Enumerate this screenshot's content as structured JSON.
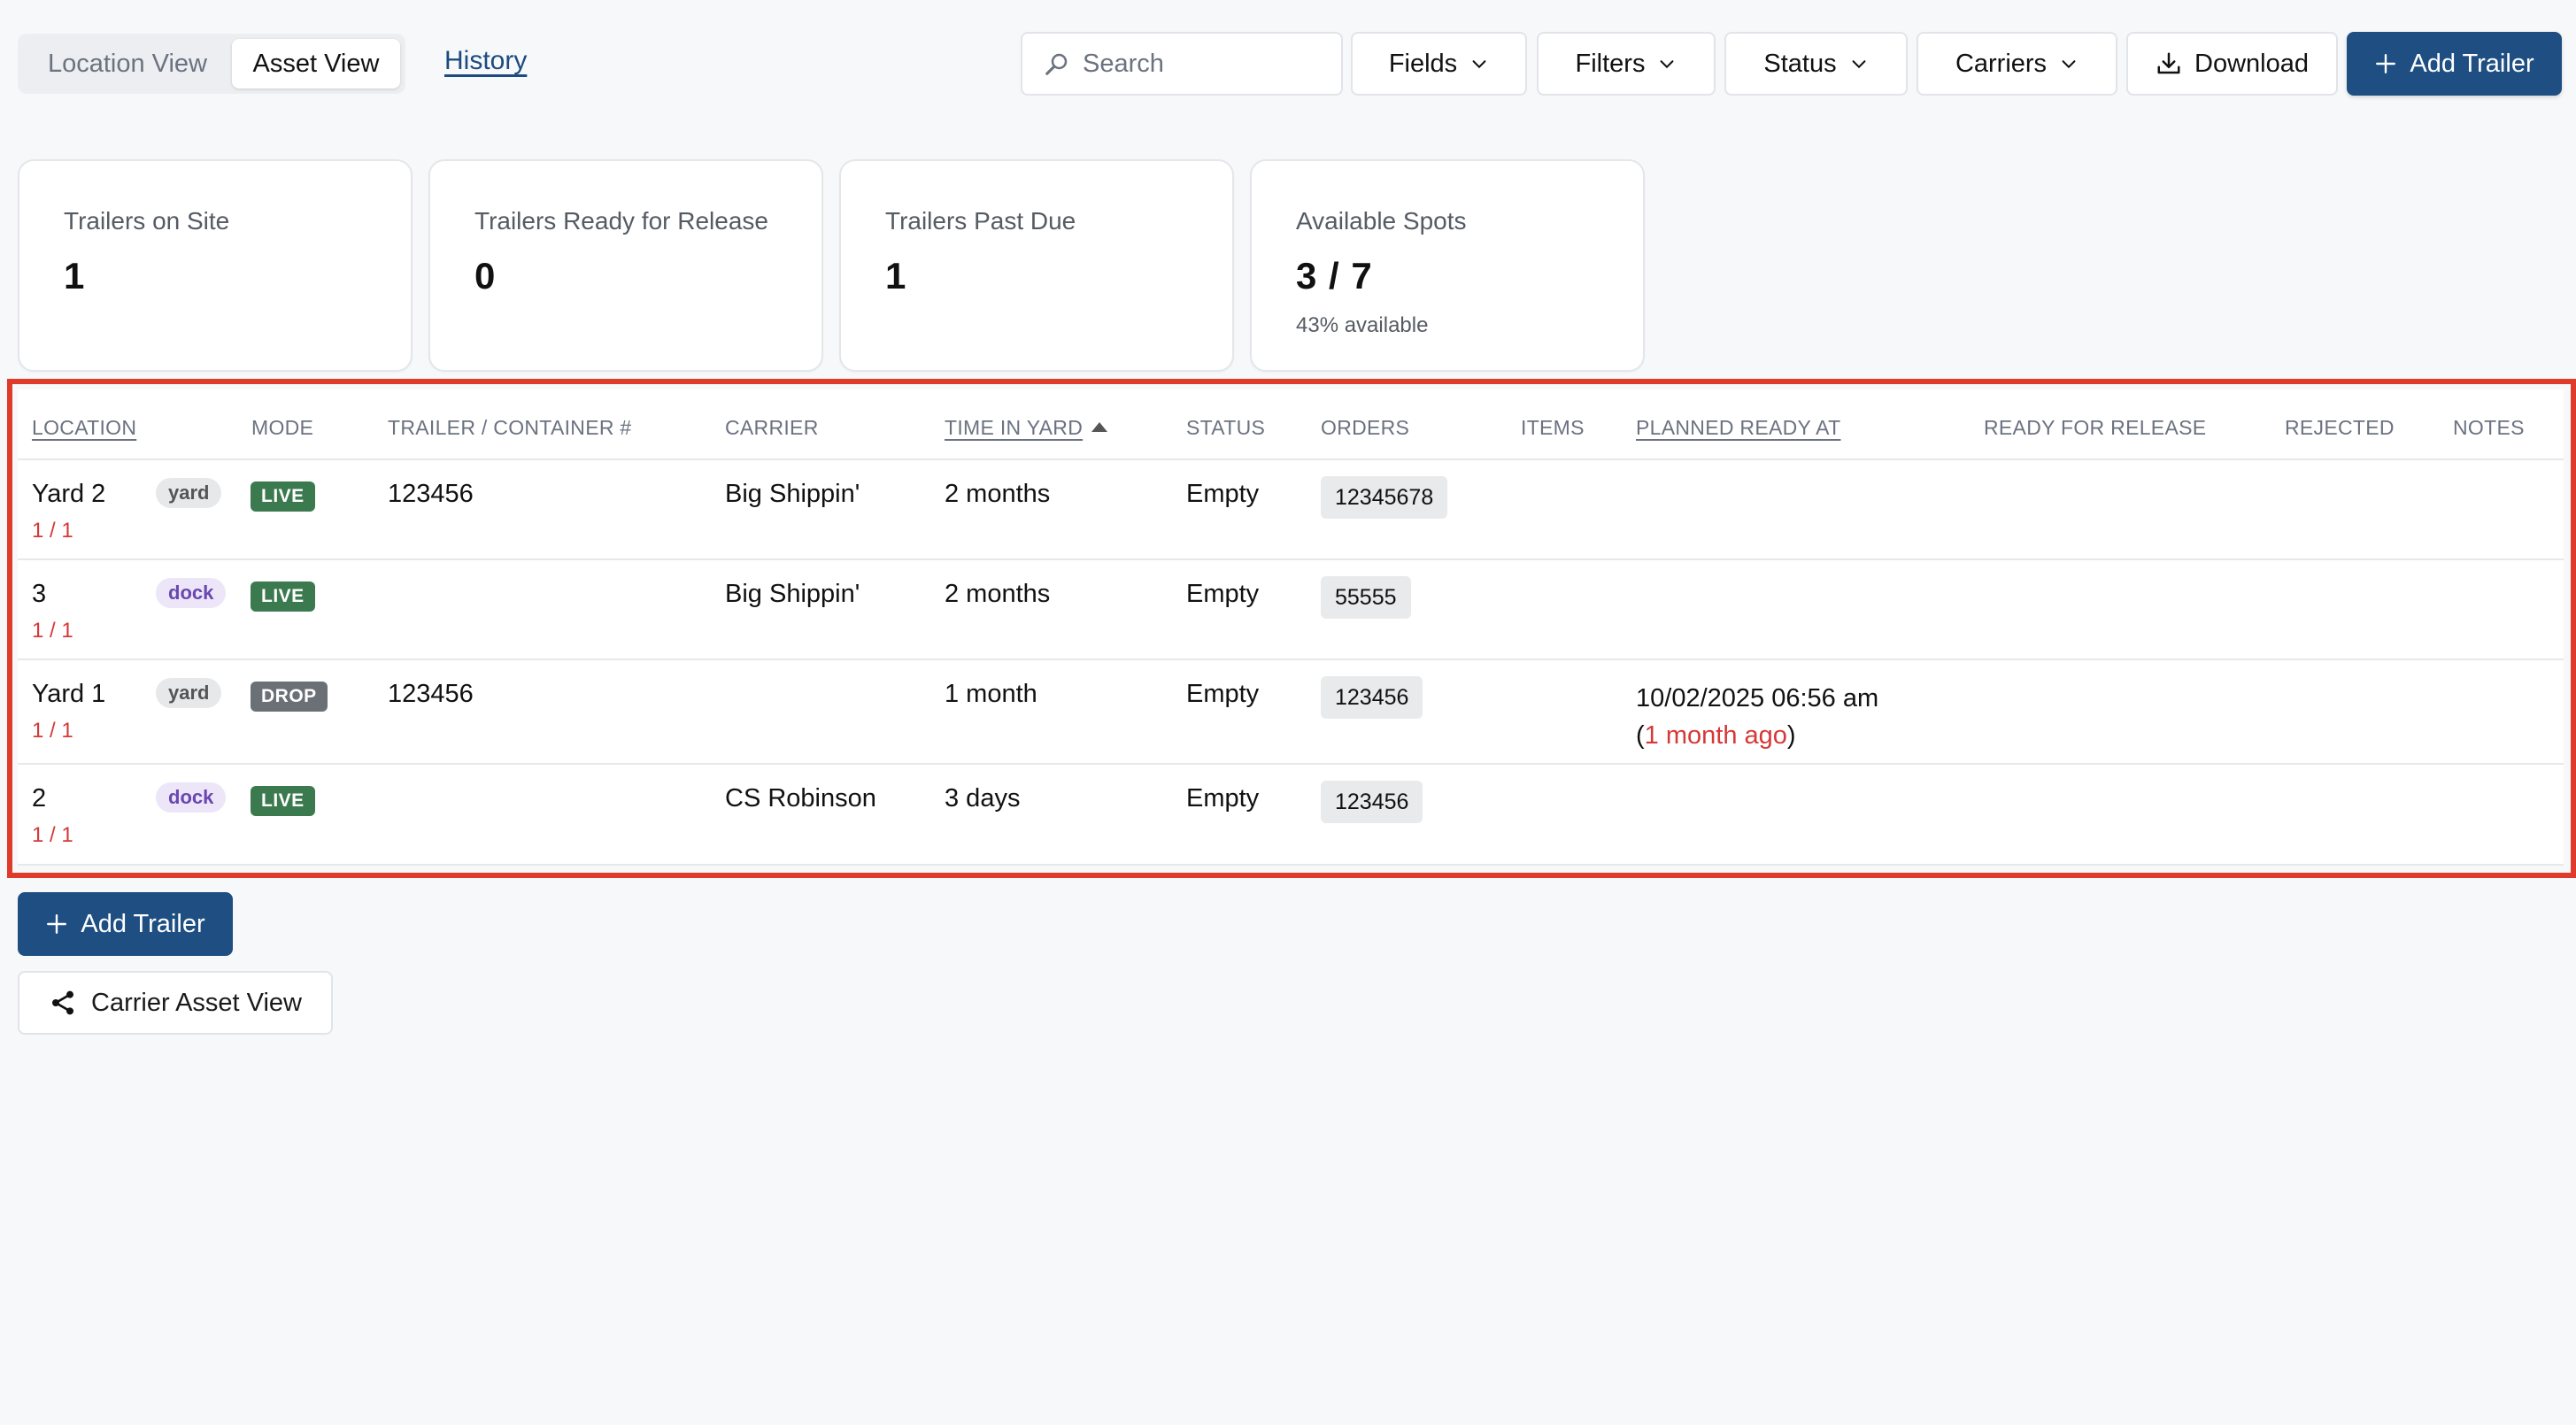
{
  "tabs": {
    "location_view": "Location View",
    "asset_view": "Asset View",
    "history": "History"
  },
  "toolbar": {
    "search_placeholder": "Search",
    "fields": "Fields",
    "filters": "Filters",
    "status": "Status",
    "carriers": "Carriers",
    "download": "Download",
    "add_trailer": "Add Trailer"
  },
  "stats": [
    {
      "label": "Trailers on Site",
      "value": "1"
    },
    {
      "label": "Trailers Ready for Release",
      "value": "0"
    },
    {
      "label": "Trailers Past Due",
      "value": "1"
    },
    {
      "label": "Available Spots",
      "value": "3 / 7",
      "sub": "43% available"
    }
  ],
  "table": {
    "columns": [
      "LOCATION",
      "MODE",
      "TRAILER / CONTAINER #",
      "CARRIER",
      "TIME IN YARD",
      "STATUS",
      "ORDERS",
      "ITEMS",
      "PLANNED READY AT",
      "READY FOR RELEASE",
      "REJECTED",
      "NOTES"
    ],
    "rows": [
      {
        "location": "Yard 2",
        "fraction": "1 / 1",
        "type": "yard",
        "mode": "LIVE",
        "trailer": "123456",
        "carrier": "Big Shippin'",
        "time": "2 months",
        "status": "Empty",
        "order": "12345678",
        "planned": "",
        "planned_ago": ""
      },
      {
        "location": "3",
        "fraction": "1 / 1",
        "type": "dock",
        "mode": "LIVE",
        "trailer": "",
        "carrier": "Big Shippin'",
        "time": "2 months",
        "status": "Empty",
        "order": "55555",
        "planned": "",
        "planned_ago": ""
      },
      {
        "location": "Yard 1",
        "fraction": "1 / 1",
        "type": "yard",
        "mode": "DROP",
        "trailer": "123456",
        "carrier": "",
        "time": "1 month",
        "status": "Empty",
        "order": "123456",
        "planned": "10/02/2025 06:56 am",
        "planned_ago": "1 month ago"
      },
      {
        "location": "2",
        "fraction": "1 / 1",
        "type": "dock",
        "mode": "LIVE",
        "trailer": "",
        "carrier": "CS Robinson",
        "time": "3 days",
        "status": "Empty",
        "order": "123456",
        "planned": "",
        "planned_ago": ""
      }
    ]
  },
  "bottom": {
    "add_trailer": "Add Trailer",
    "carrier_asset_view": "Carrier Asset View"
  },
  "colors": {
    "primary": "#1f4f82",
    "live": "#3b7a4e",
    "drop": "#6b6f76",
    "alert": "#d63838",
    "highlight": "#e03a2a"
  },
  "icons": {
    "search": "search-icon",
    "chevron": "chevron-down-icon",
    "download": "download-icon",
    "plus": "plus-icon",
    "share": "share-icon",
    "sort": "sort-ascending-icon"
  }
}
